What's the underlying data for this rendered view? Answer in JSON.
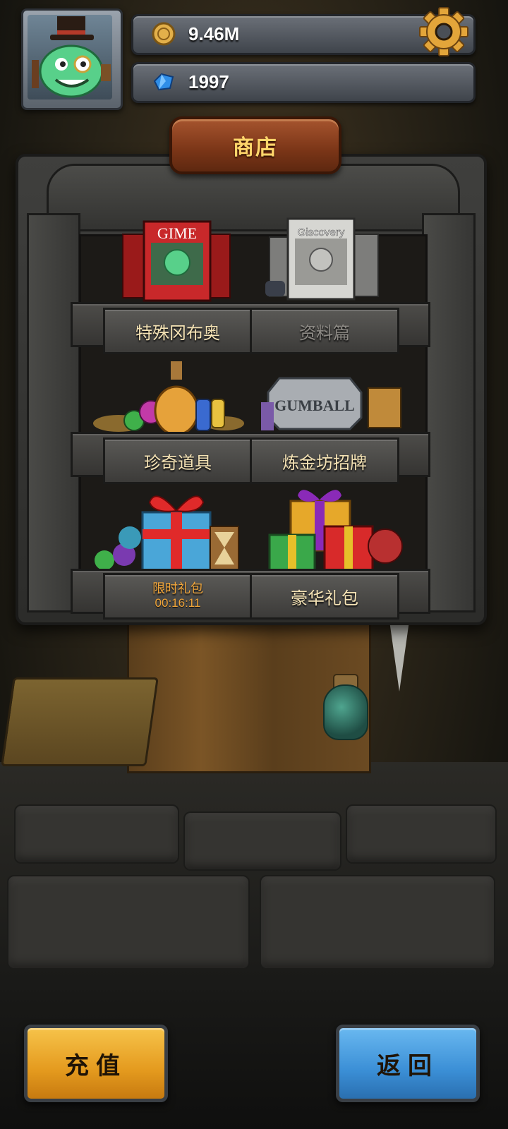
{
  "currency": {
    "gold_value": "9.46M",
    "gem_value": "1997"
  },
  "shop": {
    "title": "商店",
    "shelves": [
      {
        "left_label": "特殊冈布奥",
        "right_label": "资料篇"
      },
      {
        "left_label": "珍奇道具",
        "right_label": "炼金坊招牌"
      },
      {
        "left_label": "限时礼包",
        "left_timer": "00:16:11",
        "right_label": "豪华礼包"
      }
    ]
  },
  "art_text": {
    "magazine_gime": "GIME",
    "magazine_discovery": "Giscovery",
    "plaque": "GUMBALL"
  },
  "buttons": {
    "recharge": "充值",
    "back": "返回"
  },
  "colors": {
    "recharge_button": "#e49a1e",
    "back_button": "#3b8fd6",
    "label_text": "#f5e3b5",
    "timer_text": "#f0a53a"
  }
}
